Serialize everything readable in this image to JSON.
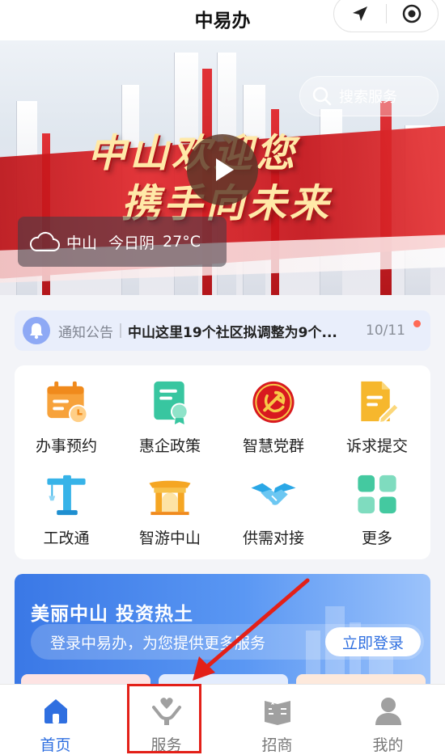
{
  "header": {
    "title": "中易办",
    "location_icon": "location-arrow-icon",
    "target_icon": "target-icon"
  },
  "banner": {
    "slogan_line1": "中山欢迎您",
    "slogan_line2": "携手向未来",
    "search_placeholder": "搜索服务",
    "weather": {
      "icon": "cloud-icon",
      "city": "中山",
      "condition": "今日阴",
      "temperature": "27°C"
    }
  },
  "notice": {
    "tag": "通知公告",
    "message": "中山这里19个社区拟调整为9个...",
    "date": "10/11"
  },
  "services": [
    {
      "label": "办事预约",
      "icon": "calendar-icon"
    },
    {
      "label": "惠企政策",
      "icon": "certificate-icon"
    },
    {
      "label": "智慧党群",
      "icon": "party-emblem-icon"
    },
    {
      "label": "诉求提交",
      "icon": "document-edit-icon"
    },
    {
      "label": "工改通",
      "icon": "crane-icon"
    },
    {
      "label": "智游中山",
      "icon": "pavilion-icon"
    },
    {
      "label": "供需对接",
      "icon": "handshake-icon"
    },
    {
      "label": "更多",
      "icon": "grid-more-icon"
    }
  ],
  "promo": {
    "title": "美丽中山 投资热土",
    "text": "登录中易办，为您提供更多服务",
    "login_label": "立即登录"
  },
  "tabs": [
    {
      "label": "首页",
      "icon": "home-icon",
      "active": true
    },
    {
      "label": "服务",
      "icon": "service-hands-heart-icon",
      "active": false
    },
    {
      "label": "招商",
      "icon": "book-icon",
      "active": false
    },
    {
      "label": "我的",
      "icon": "user-icon",
      "active": false
    }
  ],
  "colors": {
    "accent": "#2f6fe0",
    "highlight": "#e32018",
    "banner_red": "#d8191f"
  }
}
